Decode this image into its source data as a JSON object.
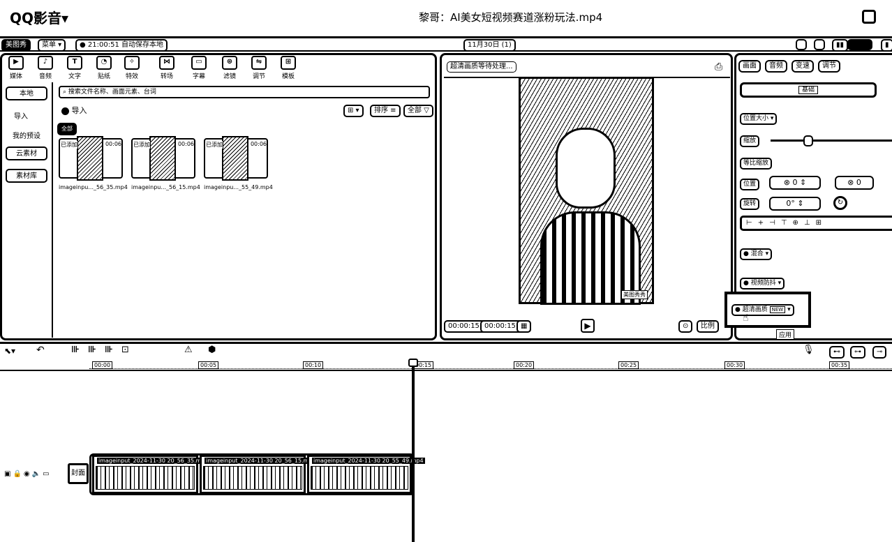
{
  "app": {
    "name": "QQ影音",
    "title": "黎哥：AI美女短视频赛道涨粉玩法.mp4"
  },
  "menubar": {
    "logo": "美图秀",
    "menu": "菜单",
    "autosave": "21:00:51 自动保存本地",
    "date": "11月30日 (1)"
  },
  "toolbar": {
    "items": [
      "媒体",
      "音频",
      "文字",
      "贴纸",
      "特效",
      "转场",
      "字幕",
      "滤镜",
      "调节",
      "模板"
    ]
  },
  "sidebar": {
    "items": [
      "本地",
      "导入",
      "我的预设",
      "云素材",
      "素材库"
    ]
  },
  "media": {
    "search_placeholder": "搜索文件名称、画面元素、台词",
    "import_label": "导入",
    "all_label": "全部",
    "sort_label": "排序",
    "filter_label": "全部",
    "clips": [
      {
        "tag": "已添加",
        "duration": "00:06",
        "name": "imageinpu..._56_35.mp4"
      },
      {
        "tag": "已添加",
        "duration": "00:06",
        "name": "imageinpu..._56_15.mp4"
      },
      {
        "tag": "已添加",
        "duration": "00:06",
        "name": "imageinpu..._55_49.mp4"
      }
    ]
  },
  "preview": {
    "status": "超清画质等待处理...",
    "time_current": "00:00:15:06",
    "time_total": "00:00:15:06",
    "zoom_btn": "适配",
    "ratio_btn": "比例",
    "watermark": "美图秀秀"
  },
  "properties": {
    "tabs": [
      "画面",
      "音频",
      "变速",
      "调节"
    ],
    "section_btn": "基础",
    "position_size": "位置大小",
    "scale_label": "缩放",
    "scale_value": 0.3,
    "uniform_scale": "等比缩放",
    "position_label": "位置",
    "pos_x": "0",
    "pos_y": "0",
    "rotate_label": "旋转",
    "rotate_value": "0°",
    "blend_label": "混合",
    "stabilize_label": "视频防抖",
    "hd_label": "超清画质",
    "hd_badge": "NEW",
    "apply_label": "应用"
  },
  "timeline": {
    "ticks": [
      "00:00",
      "00:05",
      "00:10",
      "00:15",
      "00:20",
      "00:25",
      "00:30",
      "00:35"
    ],
    "cover_label": "封面",
    "clips": [
      {
        "caption": "imageinput_2024-11-30 20_56_35.mp4"
      },
      {
        "caption": "imageinput_2024-11-30 20_56_15.mp4"
      },
      {
        "caption": "imageinput_2024-11-30 20_55_49.mp4"
      }
    ]
  }
}
